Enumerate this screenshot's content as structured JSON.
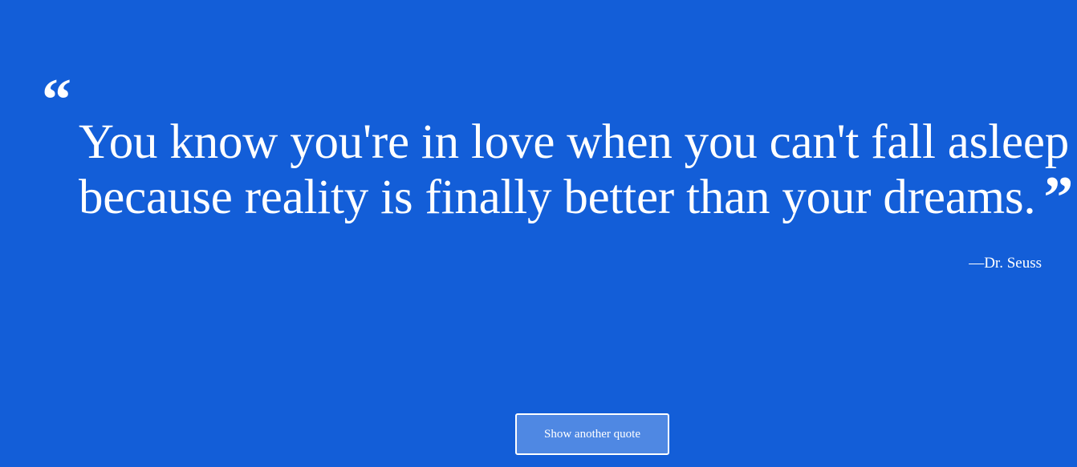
{
  "quote": {
    "open_mark": "“",
    "text": "You know you're in love when you can't fall asleep because reality is finally better than your dreams.",
    "close_mark": "”",
    "author": "—Dr. Seuss"
  },
  "actions": {
    "new_quote_label": "Show another quote"
  },
  "colors": {
    "background": "#135ed8",
    "text": "#ffffff",
    "button_background": "#4f88e3"
  }
}
